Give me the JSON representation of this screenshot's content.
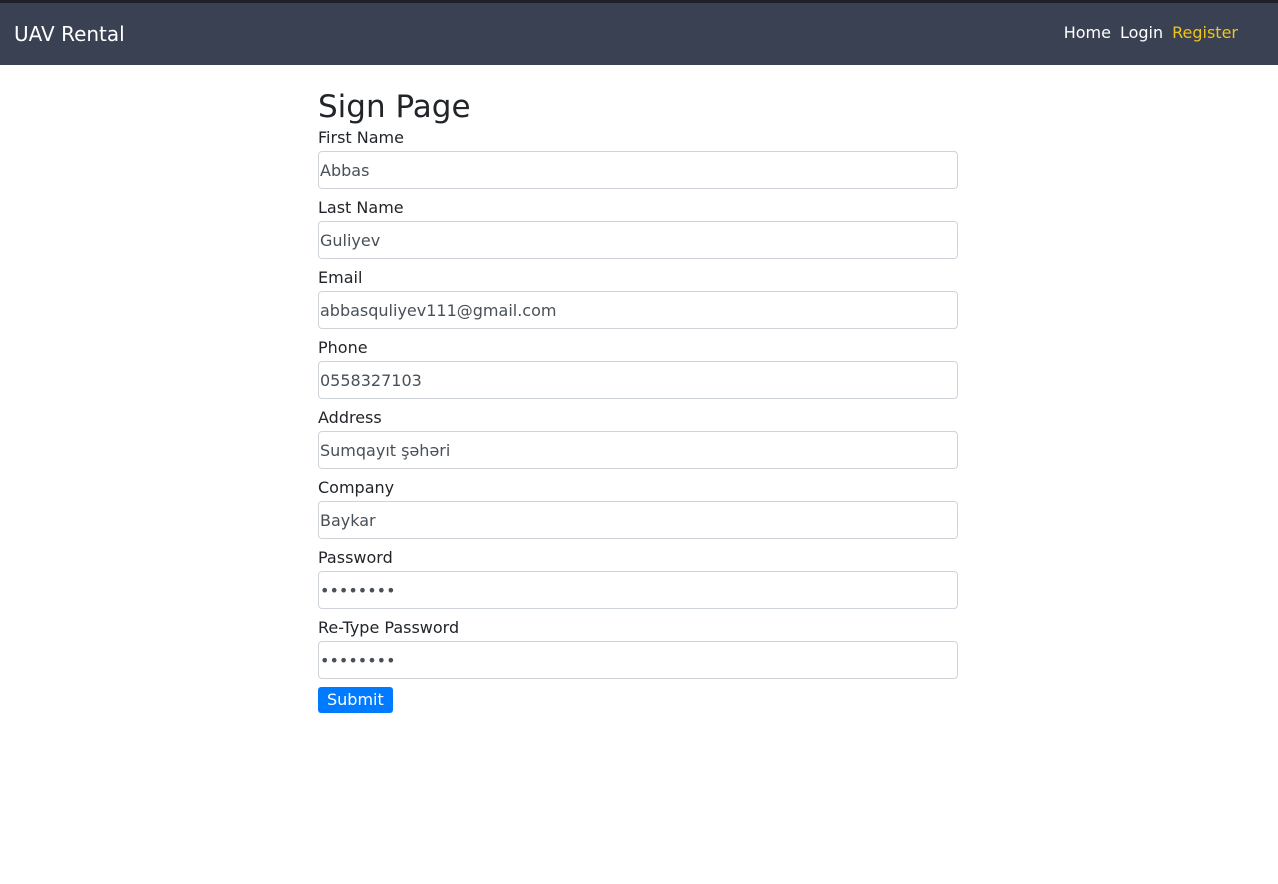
{
  "navbar": {
    "brand": "UAV Rental",
    "links": [
      {
        "label": "Home"
      },
      {
        "label": "Login"
      },
      {
        "label": "Register"
      }
    ],
    "active_color": "#f0c419",
    "background_color": "#3a4152"
  },
  "page": {
    "title": "Sign Page"
  },
  "form": {
    "fields": [
      {
        "label": "First Name",
        "value": "Abbas"
      },
      {
        "label": "Last Name",
        "value": "Guliyev"
      },
      {
        "label": "Email",
        "value": "abbasquliyev111@gmail.com"
      },
      {
        "label": "Phone",
        "value": "0558327103"
      },
      {
        "label": "Address",
        "value": "Sumqayıt şəhəri"
      },
      {
        "label": "Company",
        "value": "Baykar"
      },
      {
        "label": "Password",
        "value": "12345678"
      },
      {
        "label": "Re-Type Password",
        "value": "12345678"
      }
    ],
    "submit_label": "Submit",
    "submit_color": "#007bff"
  }
}
